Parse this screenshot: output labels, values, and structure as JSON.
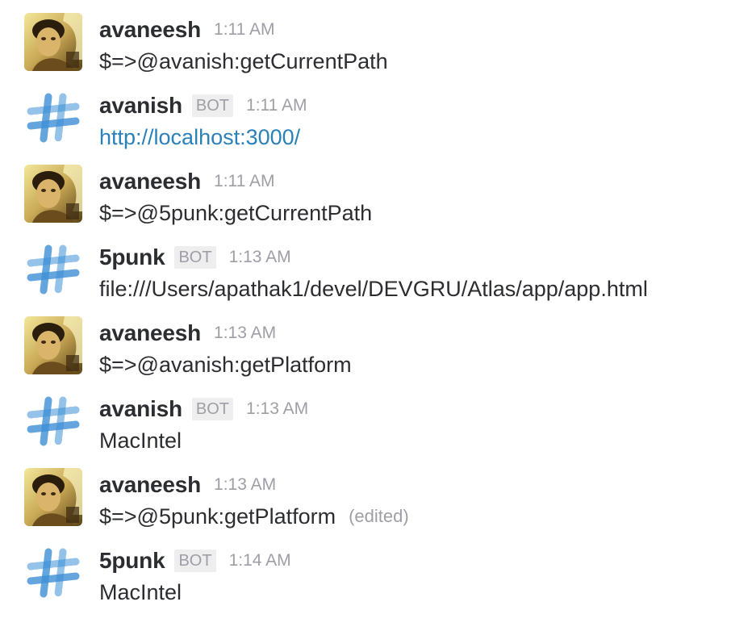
{
  "messages": [
    {
      "author": "avaneesh",
      "bot": false,
      "bot_label": "",
      "time": "1:11 AM",
      "text": "$=>@avanish:getCurrentPath",
      "link": false,
      "edited_label": "",
      "avatar_icon": "user-photo-avatar"
    },
    {
      "author": "avanish",
      "bot": true,
      "bot_label": "BOT",
      "time": "1:11 AM",
      "text": "http://localhost:3000/",
      "link": true,
      "edited_label": "",
      "avatar_icon": "slack-hash-bot-avatar"
    },
    {
      "author": "avaneesh",
      "bot": false,
      "bot_label": "",
      "time": "1:11 AM",
      "text": "$=>@5punk:getCurrentPath",
      "link": false,
      "edited_label": "",
      "avatar_icon": "user-photo-avatar"
    },
    {
      "author": "5punk",
      "bot": true,
      "bot_label": "BOT",
      "time": "1:13 AM",
      "text": "file:///Users/apathak1/devel/DEVGRU/Atlas/app/app.html",
      "link": false,
      "edited_label": "",
      "avatar_icon": "slack-hash-bot-avatar"
    },
    {
      "author": "avaneesh",
      "bot": false,
      "bot_label": "",
      "time": "1:13 AM",
      "text": "$=>@avanish:getPlatform",
      "link": false,
      "edited_label": "",
      "avatar_icon": "user-photo-avatar"
    },
    {
      "author": "avanish",
      "bot": true,
      "bot_label": "BOT",
      "time": "1:13 AM",
      "text": "MacIntel",
      "link": false,
      "edited_label": "",
      "avatar_icon": "slack-hash-bot-avatar"
    },
    {
      "author": "avaneesh",
      "bot": false,
      "bot_label": "",
      "time": "1:13 AM",
      "text": "$=>@5punk:getPlatform",
      "link": false,
      "edited_label": "(edited)",
      "avatar_icon": "user-photo-avatar"
    },
    {
      "author": "5punk",
      "bot": true,
      "bot_label": "BOT",
      "time": "1:14 AM",
      "text": "MacIntel",
      "link": false,
      "edited_label": "",
      "avatar_icon": "slack-hash-bot-avatar"
    }
  ],
  "colors": {
    "author": "#2c2d30",
    "muted": "#9e9ea6",
    "link": "#2a80b9",
    "bot_badge_bg": "#eeeeee",
    "bot_avatar_blue": "#3d8fd6"
  }
}
